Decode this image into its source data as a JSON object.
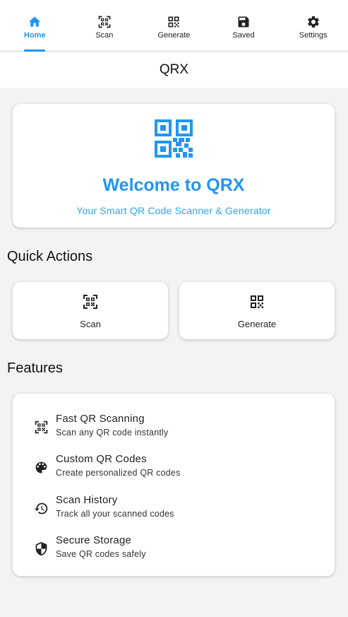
{
  "tabs": [
    {
      "label": "Home",
      "icon": "home-icon",
      "active": true
    },
    {
      "label": "Scan",
      "icon": "qr-scan-icon",
      "active": false
    },
    {
      "label": "Generate",
      "icon": "qr-code-icon",
      "active": false
    },
    {
      "label": "Saved",
      "icon": "save-icon",
      "active": false
    },
    {
      "label": "Settings",
      "icon": "gear-icon",
      "active": false
    }
  ],
  "header": {
    "title": "QRX"
  },
  "welcome": {
    "icon": "qr-code-icon",
    "title": "Welcome to QRX",
    "subtitle": "Your Smart QR Code Scanner & Generator"
  },
  "quick_actions": {
    "title": "Quick Actions",
    "items": [
      {
        "label": "Scan",
        "icon": "qr-scan-icon"
      },
      {
        "label": "Generate",
        "icon": "qr-code-icon"
      }
    ]
  },
  "features": {
    "title": "Features",
    "items": [
      {
        "title": "Fast QR Scanning",
        "subtitle": "Scan any QR code instantly",
        "icon": "qr-scan-icon"
      },
      {
        "title": "Custom QR Codes",
        "subtitle": "Create personalized QR codes",
        "icon": "palette-icon"
      },
      {
        "title": "Scan History",
        "subtitle": "Track all your scanned codes",
        "icon": "history-icon"
      },
      {
        "title": "Secure Storage",
        "subtitle": "Save QR codes safely",
        "icon": "shield-icon"
      }
    ]
  },
  "colors": {
    "accent": "#2196f3",
    "background": "#f3f3f3",
    "card": "#ffffff"
  }
}
